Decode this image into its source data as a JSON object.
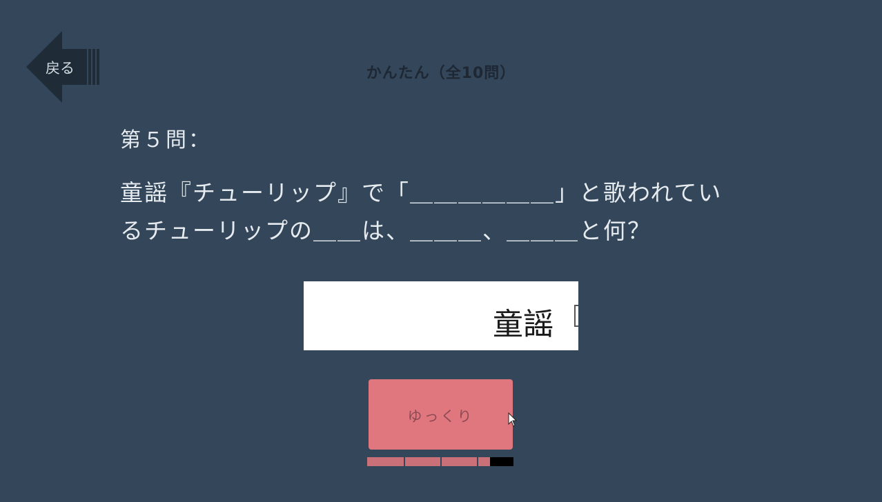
{
  "header": {
    "back_label": "戻る",
    "title": "かんたん（全10問）"
  },
  "question": {
    "number": "第５問：",
    "text": "童謡『チューリップ』で「＿＿＿＿＿＿」と歌われてい\nるチューリップの＿＿は、＿＿＿、＿＿＿と何？"
  },
  "answer": {
    "value": "童謡"
  },
  "controls": {
    "slow_label": "ゆっくり"
  },
  "timer": {
    "remaining_fraction": 0.84,
    "segments": 4
  },
  "colors": {
    "background": "#344659",
    "button": "#e0777f",
    "progress": "#c97079"
  },
  "icons": {
    "back": "arrow-left-icon",
    "cursor": "mouse-pointer-icon"
  }
}
